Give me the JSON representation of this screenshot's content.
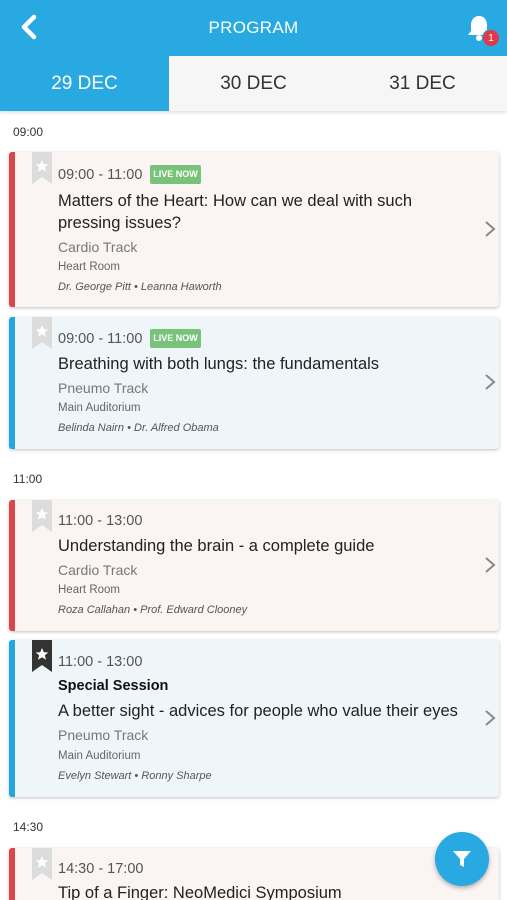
{
  "header": {
    "title": "PROGRAM",
    "notification_count": "1"
  },
  "tabs": [
    {
      "label": "29 DEC",
      "active": true
    },
    {
      "label": "30 DEC",
      "active": false
    },
    {
      "label": "31 DEC",
      "active": false
    }
  ],
  "groups": [
    {
      "time": "09:00"
    },
    {
      "time": "11:00"
    },
    {
      "time": "14:30"
    }
  ],
  "sessions": [
    {
      "time": "09:00 - 11:00",
      "live": "LIVE NOW",
      "title": "Matters of the Heart: How can we deal with such pressing issues?",
      "track": "Cardio Track",
      "room": "Heart Room",
      "speakers": "Dr. George Pitt • Leanna Haworth",
      "bookmarked": false
    },
    {
      "time": "09:00 - 11:00",
      "live": "LIVE NOW",
      "title": "Breathing with both lungs: the fundamentals",
      "track": "Pneumo Track",
      "room": "Main Auditorium",
      "speakers": "Belinda Nairn • Dr. Alfred Obama",
      "bookmarked": false
    },
    {
      "time": "11:00 - 13:00",
      "title": "Understanding the brain - a complete guide",
      "track": "Cardio Track",
      "room": "Heart Room",
      "speakers": "Roza Callahan • Prof. Edward Clooney",
      "bookmarked": false
    },
    {
      "time": "11:00 - 13:00",
      "special": "Special Session",
      "title": "A better sight - advices for people who value their eyes",
      "track": "Pneumo Track",
      "room": "Main Auditorium",
      "speakers": "Evelyn Stewart • Ronny Sharpe",
      "bookmarked": true
    },
    {
      "time": "14:30 - 17:00",
      "title": "Tip of a Finger: NeoMedici Symposium",
      "bookmarked": false
    }
  ],
  "colors": {
    "accent": "#29a9e1",
    "cardio": "#d9474b",
    "pneumo": "#25a6de",
    "live": "#79c27a",
    "badge": "#e03a4a"
  },
  "icons": {
    "back": "chevron-left-icon",
    "bell": "bell-icon",
    "bookmark": "bookmark-star-icon",
    "chevron": "chevron-right-icon",
    "filter": "filter-icon"
  }
}
